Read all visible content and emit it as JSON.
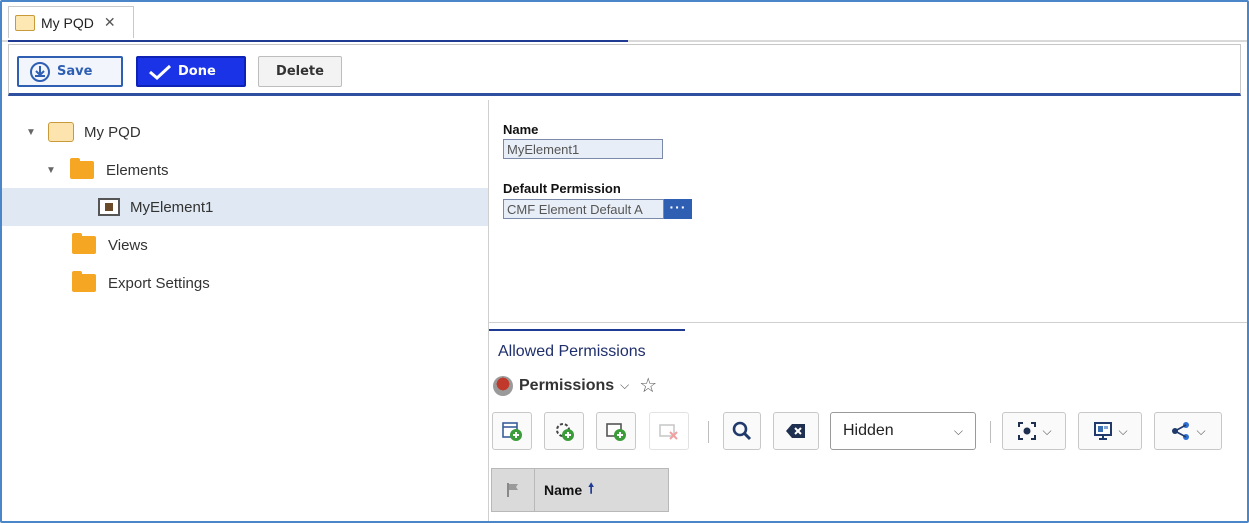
{
  "tab": {
    "label": "My PQD",
    "close": "✕",
    "icon": "pqd-icon"
  },
  "toolbar": {
    "save_label": "Save",
    "done_label": "Done",
    "delete_label": "Delete"
  },
  "tree": {
    "items": [
      {
        "label": "My PQD",
        "expanded": true,
        "icon": "pqd-icon"
      },
      {
        "label": "Elements",
        "expanded": true,
        "icon": "folder-icon"
      },
      {
        "label": "MyElement1",
        "selected": true,
        "icon": "element-icon"
      },
      {
        "label": "Views",
        "icon": "folder-icon"
      },
      {
        "label": "Export Settings",
        "icon": "folder-icon"
      }
    ]
  },
  "properties": {
    "name_label": "Name",
    "name_value": "MyElement1",
    "permission_label": "Default Permission",
    "permission_value": "CMF Element Default A",
    "permission_button": "···"
  },
  "permissions": {
    "title": "Allowed Permissions",
    "view_label": "Permissions",
    "filter_select": "Hidden",
    "grid_columns": [
      "",
      "Name"
    ],
    "sort": "ascending"
  },
  "colors": {
    "accent": "#1f3a93",
    "done_button": "#1a33e6",
    "selection": "#dfe8f3",
    "folder": "#f5a623"
  }
}
